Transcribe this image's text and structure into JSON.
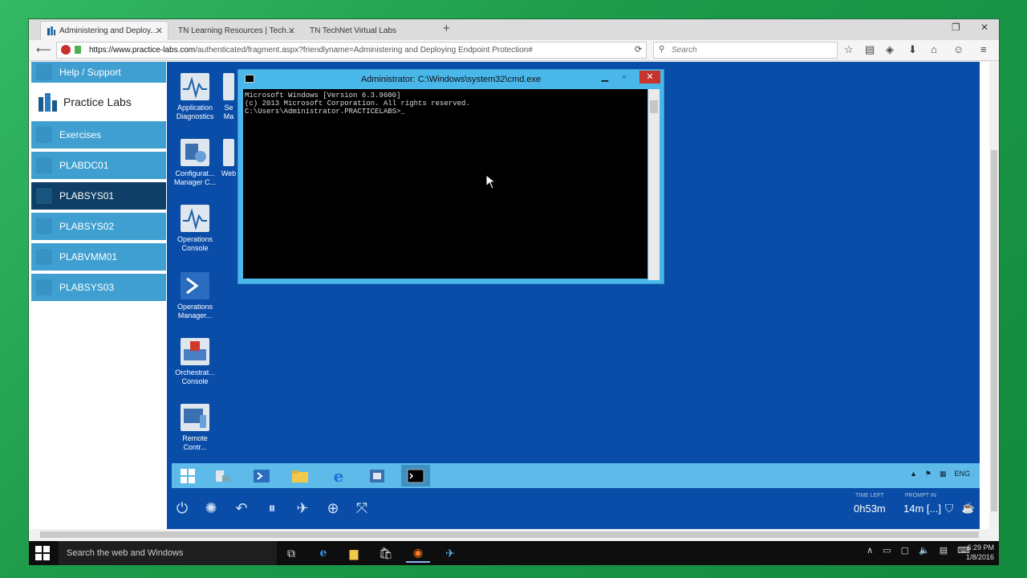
{
  "browser": {
    "tabs": [
      {
        "label": "Administering and Deploy...",
        "active": true
      },
      {
        "label": "TN Learning Resources | Tech...",
        "active": false
      },
      {
        "label": "TN  TechNet Virtual Labs",
        "active": false
      }
    ],
    "url_host": "https://www.practice-labs.com",
    "url_path": "/authenticated/fragment.aspx?friendlyname=Administering and Deploying Endpoint Protection#",
    "search_placeholder": "Search"
  },
  "sidebar": {
    "help": "Help / Support",
    "brand": "Practice Labs",
    "items": [
      {
        "label": "Exercises",
        "selected": false
      },
      {
        "label": "PLABDC01",
        "selected": false
      },
      {
        "label": "PLABSYS01",
        "selected": true
      },
      {
        "label": "PLABSYS02",
        "selected": false
      },
      {
        "label": "PLABVMM01",
        "selected": false
      },
      {
        "label": "PLABSYS03",
        "selected": false
      }
    ]
  },
  "desktop_icons": [
    {
      "label": "Application Diagnostics",
      "icon": "pulse-chart-icon"
    },
    {
      "label": "Configurat... Manager C...",
      "icon": "config-manager-icon"
    },
    {
      "label": "Operations Console",
      "icon": "pulse-chart-icon"
    },
    {
      "label": "Operations Manager...",
      "icon": "powershell-icon"
    },
    {
      "label": "Orchestrat... Console",
      "icon": "orchestrator-icon"
    },
    {
      "label": "Remote Contr...",
      "icon": "remote-control-icon"
    }
  ],
  "partial_icons": [
    {
      "label": "Se Ma"
    },
    {
      "label": "Web"
    }
  ],
  "cmd": {
    "title": "Administrator: C:\\Windows\\system32\\cmd.exe",
    "lines": [
      "Microsoft Windows [Version 6.3.9600]",
      "(c) 2013 Microsoft Corporation. All rights reserved.",
      "",
      "C:\\Users\\Administrator.PRACTICELABS>_"
    ]
  },
  "remote_tray": {
    "lang": "ENG"
  },
  "control_bar": {
    "time_left_label": "TIME LEFT",
    "time_left": "0h53m",
    "prompt_label": "PROMPT IN",
    "prompt_in": "14m [...]"
  },
  "win_taskbar": {
    "search_placeholder": "Search the web and Windows",
    "time": "6:29 PM",
    "date": "1/8/2016"
  },
  "colors": {
    "sidebar_item": "#3f9fd1",
    "sidebar_selected": "#0f3f66",
    "remote_desktop": "#0a4da8",
    "remote_taskbar": "#5dbae9",
    "cmd_close": "#c8332b"
  }
}
